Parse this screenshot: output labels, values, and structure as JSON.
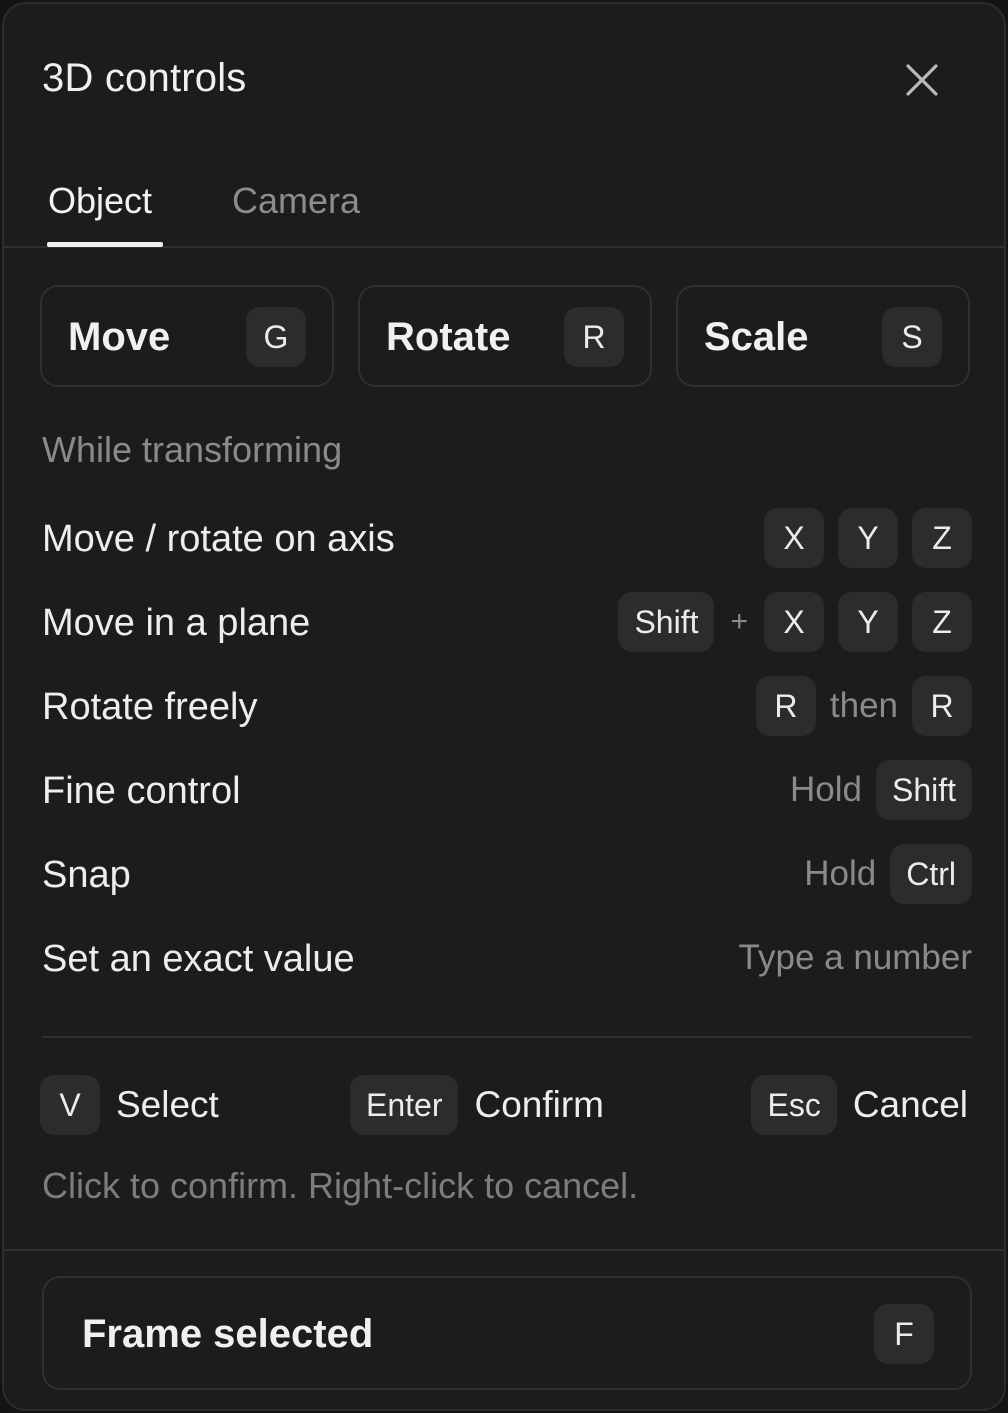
{
  "header": {
    "title": "3D controls",
    "close_icon": "close-icon"
  },
  "tabs": [
    {
      "label": "Object",
      "active": true
    },
    {
      "label": "Camera",
      "active": false
    }
  ],
  "tools": [
    {
      "label": "Move",
      "key": "G"
    },
    {
      "label": "Rotate",
      "key": "R"
    },
    {
      "label": "Scale",
      "key": "S"
    }
  ],
  "section_label": "While transforming",
  "shortcuts": [
    {
      "label": "Move / rotate on axis",
      "keys": [
        "X",
        "Y",
        "Z"
      ]
    },
    {
      "label": "Move in a plane",
      "keys": [
        "Shift",
        "+",
        "X",
        "Y",
        "Z"
      ]
    },
    {
      "label": "Rotate freely",
      "keys": [
        "R",
        "then",
        "R"
      ]
    },
    {
      "label": "Fine control",
      "keys": [
        "Hold",
        "Shift"
      ]
    },
    {
      "label": "Snap",
      "keys": [
        "Hold",
        "Ctrl"
      ]
    },
    {
      "label": "Set an exact value",
      "text": "Type a number"
    }
  ],
  "actions": [
    {
      "key": "V",
      "label": "Select"
    },
    {
      "key": "Enter",
      "label": "Confirm"
    },
    {
      "key": "Esc",
      "label": "Cancel"
    }
  ],
  "hint": "Click to confirm. Right-click to cancel.",
  "footer": {
    "label": "Frame selected",
    "key": "F"
  },
  "colors": {
    "panel": "#1c1c1b",
    "border": "#2f2f2e",
    "key_bg": "#2c2c2b",
    "text": "#ececec",
    "muted": "#8a8a88"
  }
}
